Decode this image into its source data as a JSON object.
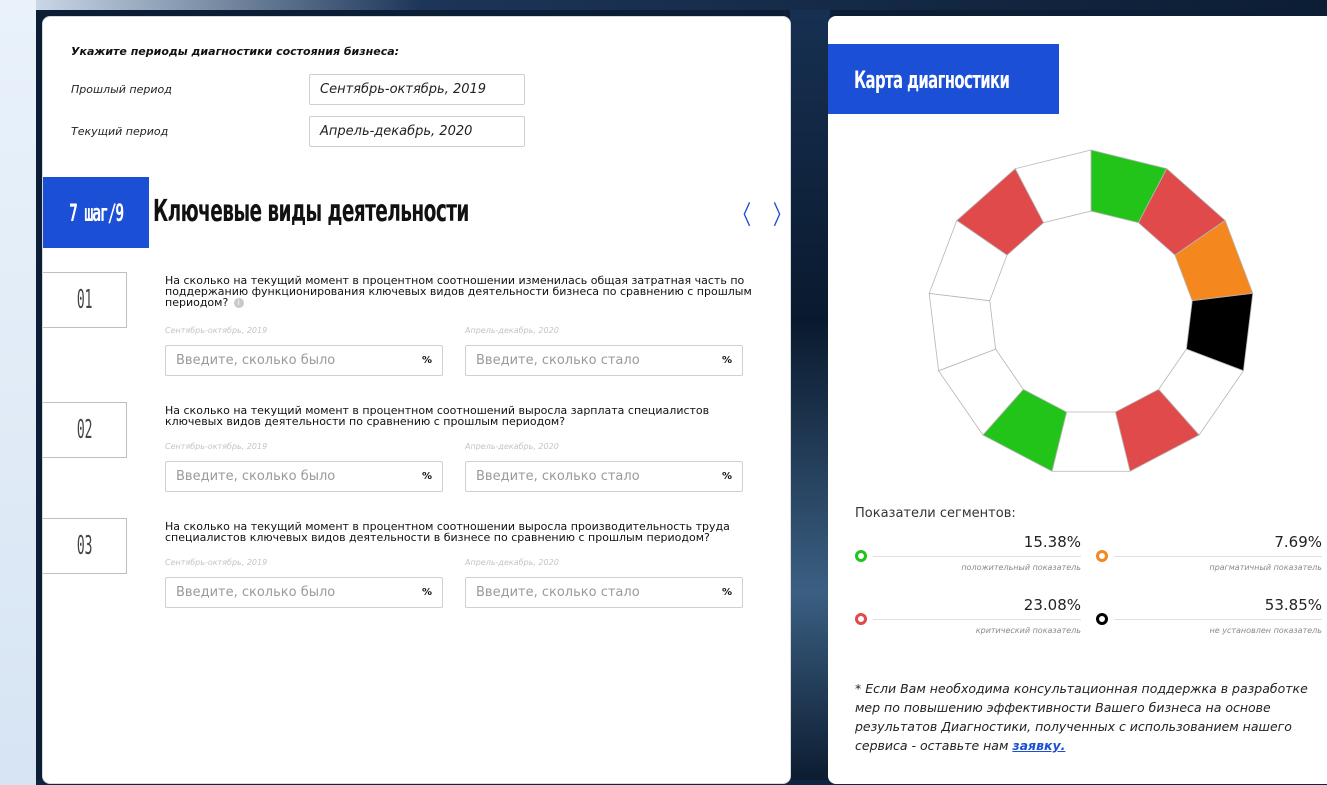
{
  "periods": {
    "title": "Укажите периоды диагностики состояния бизнеса:",
    "past_label": "Прошлый период",
    "past_value": "Сентябрь-октябрь, 2019",
    "current_label": "Текущий период",
    "current_value": "Апрель-декабрь, 2020"
  },
  "step": {
    "badge": "7 шаг/9",
    "title": "Ключевые виды деятельности",
    "prev_icon": "chevron-left-icon",
    "next_icon": "chevron-right-icon"
  },
  "questions": [
    {
      "num": "01",
      "text": "На сколько на текущий момент в процентном соотношении изменилась общая затратная часть по поддержанию функционирования ключевых видов деятельности бизнеса по сравнению с прошлым периодом?",
      "period_before": "Сентябрь-октябрь, 2019",
      "period_after": "Апрель-декабрь, 2020",
      "placeholder_before": "Введите, сколько было",
      "placeholder_after": "Введите, сколько стало",
      "unit": "%"
    },
    {
      "num": "02",
      "text": "На сколько на текущий момент в процентном соотношений выросла зарплата специалистов ключевых видов деятельности по сравнению с прошлым периодом?",
      "period_before": "Сентябрь-октябрь, 2019",
      "period_after": "Апрель-декабрь, 2020",
      "placeholder_before": "Введите, сколько было",
      "placeholder_after": "Введите, сколько стало",
      "unit": "%"
    },
    {
      "num": "03",
      "text": "На сколько на текущий момент в процентном соотношении выросла производительность труда специалистов ключевых видов деятельности в бизнесе по сравнению с прошлым периодом?",
      "period_before": "Сентябрь-октябрь, 2019",
      "period_after": "Апрель-декабрь, 2020",
      "placeholder_before": "Введите, сколько было",
      "placeholder_after": "Введите, сколько стало",
      "unit": "%"
    }
  ],
  "map": {
    "title": "Карта диагностики",
    "segments_title": "Показатели сегментов:",
    "colors": {
      "positive": "#22c41a",
      "critical": "#e04a4a",
      "pragmatic": "#f5871f",
      "unset": "#000000",
      "empty": "#ffffff",
      "accent": "#1a4fd6"
    },
    "donut_segments": [
      "positive",
      "critical",
      "pragmatic",
      "unset",
      "empty",
      "critical",
      "empty",
      "positive",
      "empty",
      "empty",
      "empty",
      "critical",
      "empty"
    ],
    "indicators": [
      {
        "value": "15.38%",
        "caption": "положительный показатель",
        "color": "#22c41a"
      },
      {
        "value": "7.69%",
        "caption": "прагматичный показатель",
        "color": "#f5871f"
      },
      {
        "value": "23.08%",
        "caption": "критический показатель",
        "color": "#e04a4a"
      },
      {
        "value": "53.85%",
        "caption": "не установлен показатель",
        "color": "#000000"
      }
    ],
    "note_text": "* Если Вам необходима консультационная поддержка в разработке мер по повышению эффективности Вашего бизнеса на основе результатов Диагностики, полученных с использованием нашего сервиса - оставьте нам ",
    "note_link": "заявку."
  }
}
